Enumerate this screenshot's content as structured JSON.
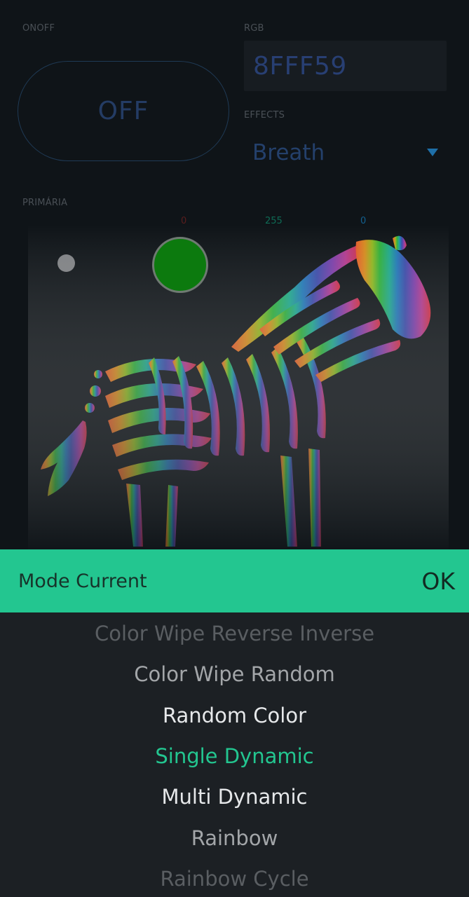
{
  "onoff": {
    "label": "ONOFF",
    "value": "OFF"
  },
  "rgb": {
    "label": "RGB",
    "value": "8FFF59"
  },
  "effects": {
    "label": "EFFECTS",
    "value": "Breath"
  },
  "primaria": {
    "label": "PRIMÁRIA",
    "r": "0",
    "g": "255",
    "b": "0",
    "r_color": "#5a1a1a",
    "g_color": "#0f6b55",
    "b_color": "#12608f",
    "selected_color": "#0c7a0e"
  },
  "modal": {
    "title": "Mode Current",
    "ok": "OK",
    "header_color": "#23c690",
    "items": [
      {
        "label": "Color Wipe Reverse Inverse",
        "state": "far"
      },
      {
        "label": "Color Wipe Random",
        "state": "near"
      },
      {
        "label": "Random Color",
        "state": "adjacent"
      },
      {
        "label": "Single Dynamic",
        "state": "selected"
      },
      {
        "label": "Multi Dynamic",
        "state": "adjacent"
      },
      {
        "label": "Rainbow",
        "state": "near"
      },
      {
        "label": "Rainbow Cycle",
        "state": "far"
      }
    ]
  },
  "icons": {
    "dropdown": "caret-down-icon",
    "zebra": "zebra-rgb-icon"
  }
}
